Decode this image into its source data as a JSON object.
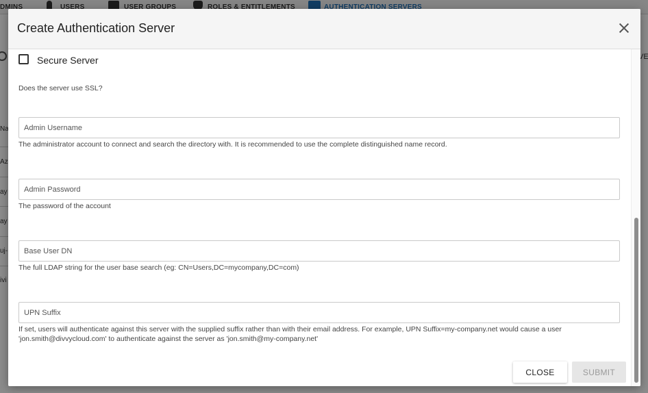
{
  "background": {
    "nav": [
      {
        "label": "DMINS"
      },
      {
        "label": "USERS"
      },
      {
        "label": "USER GROUPS"
      },
      {
        "label": "ROLES & ENTITLEMENTS"
      },
      {
        "label": "AUTHENTICATION SERVERS"
      }
    ],
    "row_fragments": [
      "Na",
      "Az",
      "ay",
      "ay",
      "uj-",
      "ivi"
    ],
    "right_fragment": "VE"
  },
  "modal": {
    "title": "Create Authentication Server",
    "secure_server": {
      "label": "Secure Server",
      "checked": false,
      "help": "Does the server use SSL?"
    },
    "fields": [
      {
        "placeholder": "Admin Username",
        "value": "",
        "help": "The administrator account to connect and search the directory with. It is recommended to use the complete distinguished name record."
      },
      {
        "placeholder": "Admin Password",
        "value": "",
        "help": "The password of the account"
      },
      {
        "placeholder": "Base User DN",
        "value": "",
        "help": "The full LDAP string for the user base search (eg: CN=Users,DC=mycompany,DC=com)"
      },
      {
        "placeholder": "UPN Suffix",
        "value": "",
        "help_line1": "If set, users will authenticate against this server with the supplied suffix rather than with their email address. For example, UPN Suffix=my-company.net would cause a user",
        "help_line2": "'jon.smith@divvycloud.com' to authenticate against the server as 'jon.smith@my-company.net'"
      }
    ],
    "buttons": {
      "close": "CLOSE",
      "submit": "SUBMIT"
    }
  },
  "colors": {
    "accent": "#1f6fb5",
    "submit_disabled_bg": "#e6e6e6",
    "submit_disabled_text": "#9a9a9a"
  },
  "icons": [
    "user-icon",
    "user-group-icon",
    "shield-icon",
    "server-icon",
    "search-icon",
    "close-icon"
  ]
}
